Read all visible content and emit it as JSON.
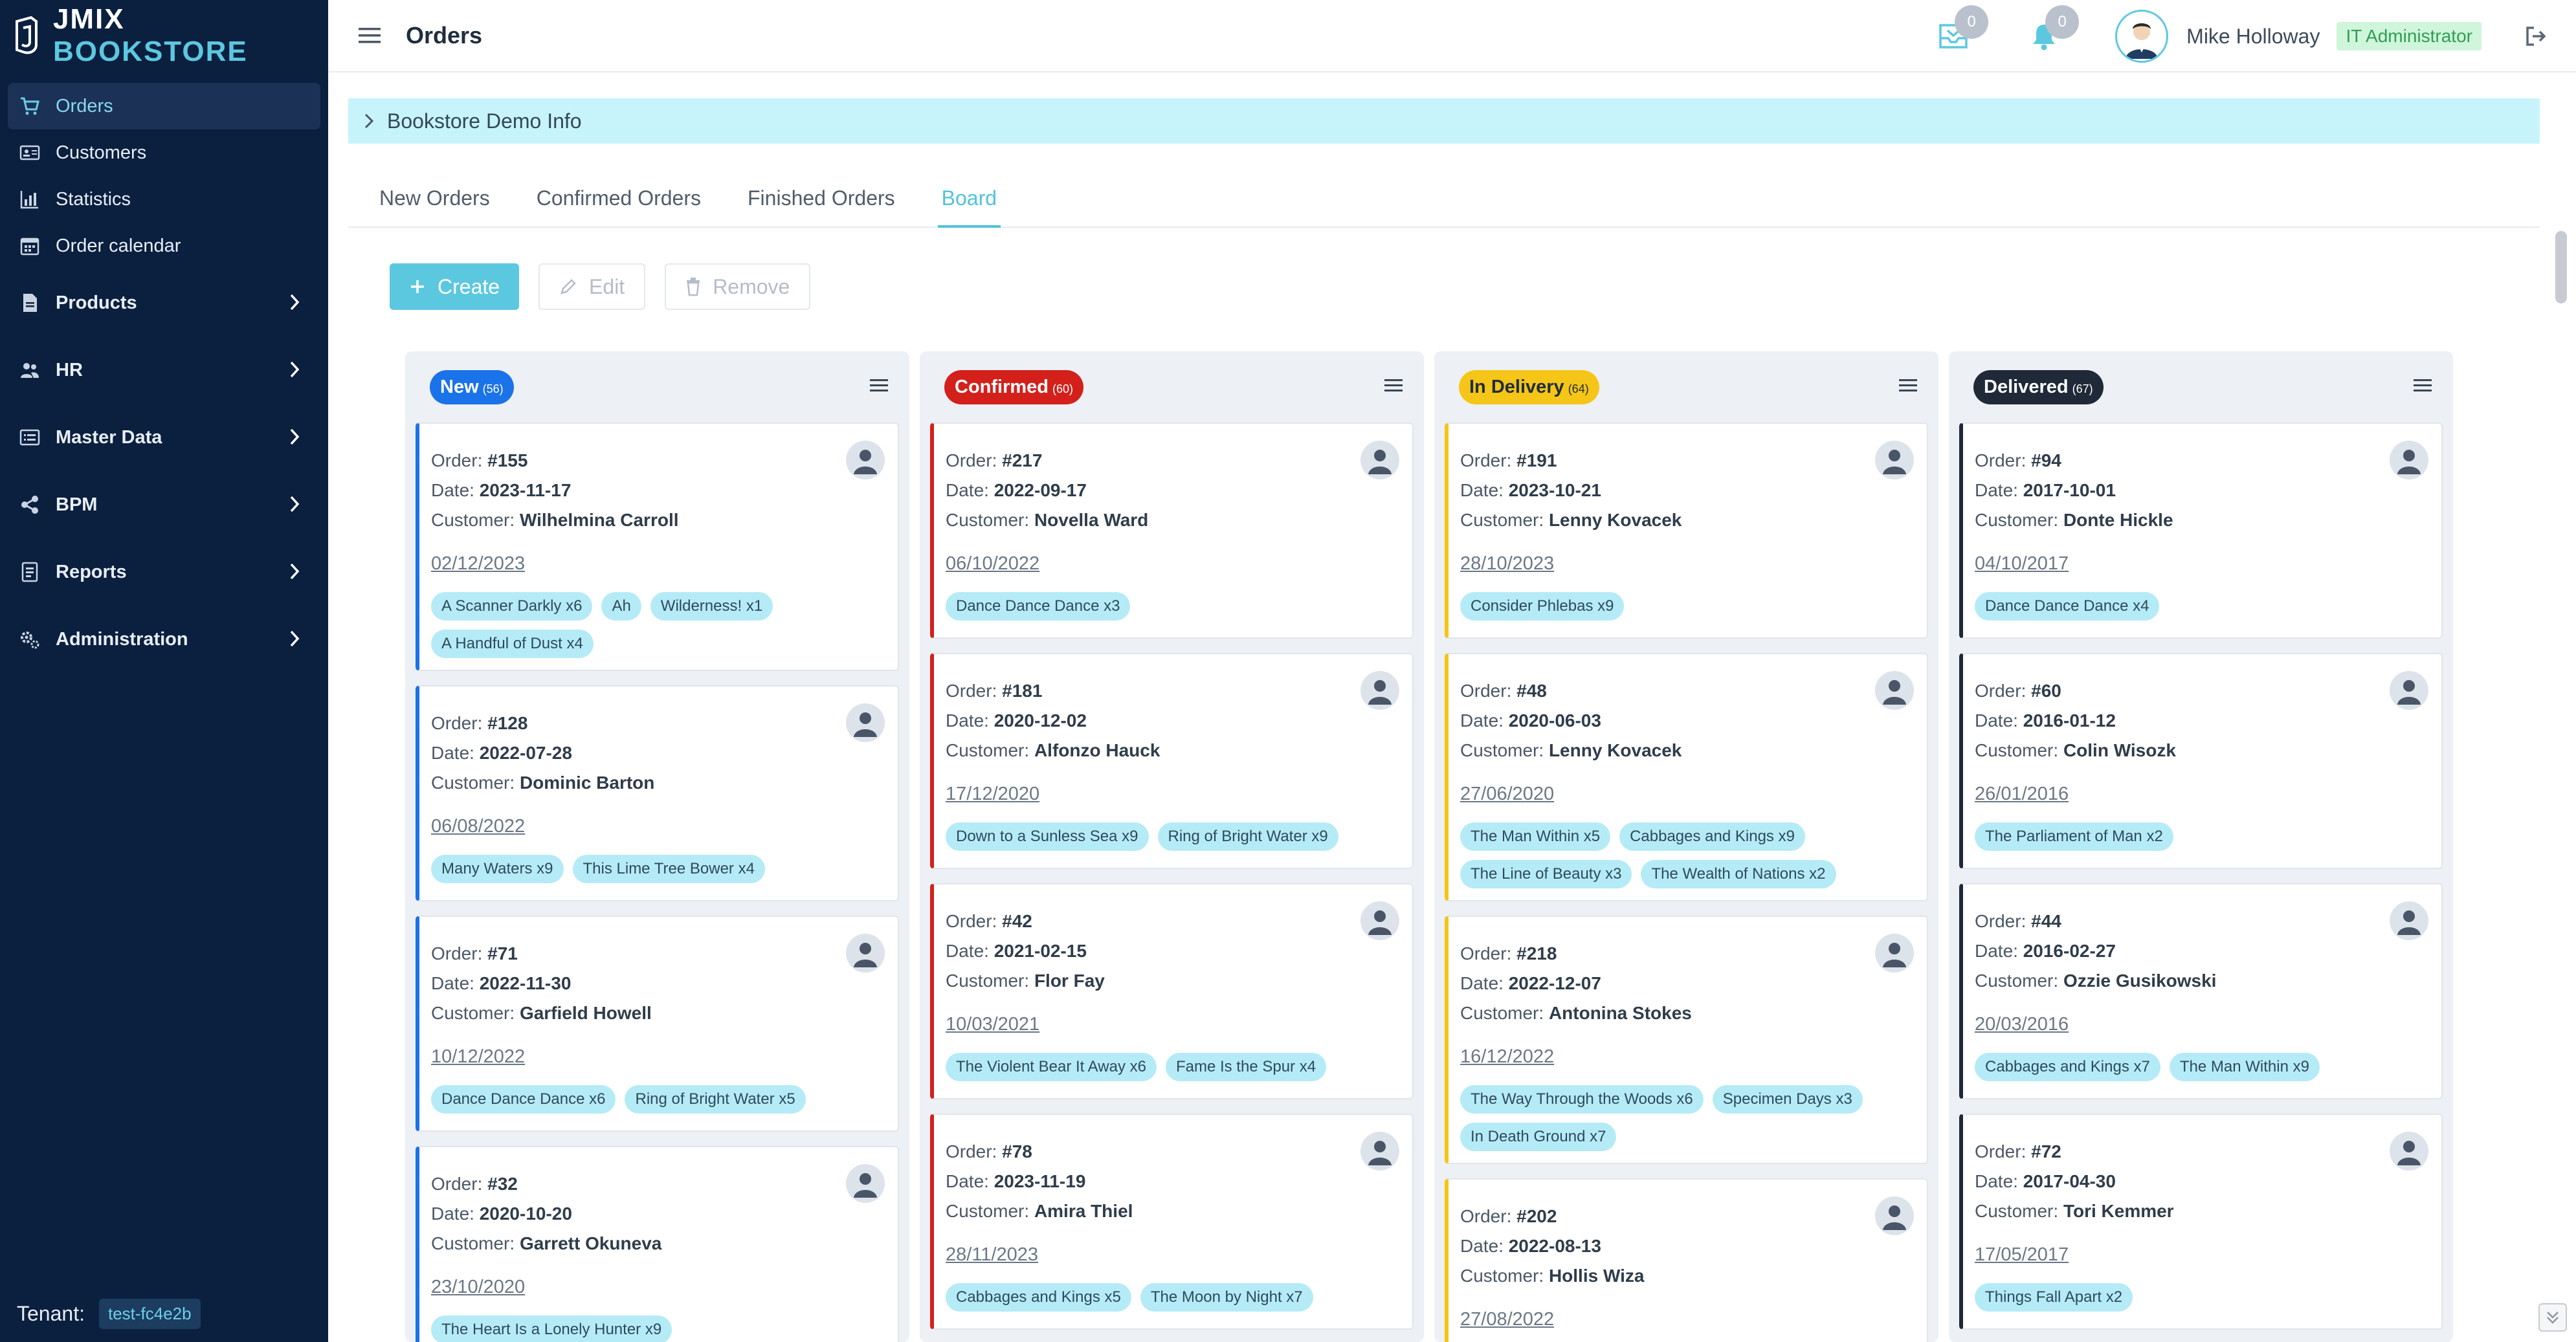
{
  "brand": {
    "prefix": "JMIX",
    "suffix": "BOOKSTORE"
  },
  "sidebar": {
    "items": [
      {
        "label": "Orders",
        "icon": "cart-icon",
        "active": true
      },
      {
        "label": "Customers",
        "icon": "address-card-icon"
      },
      {
        "label": "Statistics",
        "icon": "chart-icon"
      },
      {
        "label": "Order calendar",
        "icon": "calendar-icon"
      }
    ],
    "groups": [
      {
        "label": "Products",
        "icon": "file-icon"
      },
      {
        "label": "HR",
        "icon": "users-icon"
      },
      {
        "label": "Master Data",
        "icon": "list-icon"
      },
      {
        "label": "BPM",
        "icon": "share-icon"
      },
      {
        "label": "Reports",
        "icon": "report-icon"
      },
      {
        "label": "Administration",
        "icon": "cogs-icon"
      }
    ],
    "tenant_label": "Tenant:",
    "tenant_value": "test-fc4e2b"
  },
  "header": {
    "title": "Orders",
    "inbox_count": "0",
    "notifications_count": "0",
    "user_name": "Mike Holloway",
    "role": "IT Administrator"
  },
  "infobar": {
    "label": "Bookstore Demo Info"
  },
  "tabs": [
    "New Orders",
    "Confirmed Orders",
    "Finished Orders",
    "Board"
  ],
  "active_tab": "Board",
  "toolbar": {
    "create": "Create",
    "edit": "Edit",
    "remove": "Remove"
  },
  "card_labels": {
    "order": "Order:",
    "date": "Date:",
    "customer": "Customer:"
  },
  "colors": {
    "new": "#1a73e8",
    "confirmed": "#d3201b",
    "in_delivery": "#f5c518",
    "delivered": "#1f2937",
    "accent": "#5cc8e0",
    "sidebar": "#0b1f3f"
  },
  "columns": [
    {
      "title": "New",
      "count": "(56)",
      "cards": [
        {
          "order": "#155",
          "date": "2023-11-17",
          "customer": "Wilhelmina Carroll",
          "delivery": "02/12/2023",
          "items": [
            "A Scanner Darkly x6",
            "Ah",
            "Wilderness! x1",
            "A Handful of Dust x4"
          ]
        },
        {
          "order": "#128",
          "date": "2022-07-28",
          "customer": "Dominic Barton",
          "delivery": "06/08/2022",
          "items": [
            "Many Waters x9",
            "This Lime Tree Bower x4"
          ]
        },
        {
          "order": "#71",
          "date": "2022-11-30",
          "customer": "Garfield Howell",
          "delivery": "10/12/2022",
          "items": [
            "Dance Dance Dance x6",
            "Ring of Bright Water x5"
          ]
        },
        {
          "order": "#32",
          "date": "2020-10-20",
          "customer": "Garrett Okuneva",
          "delivery": "23/10/2020",
          "items": [
            "The Heart Is a Lonely Hunter x9"
          ]
        }
      ]
    },
    {
      "title": "Confirmed",
      "count": "(60)",
      "cards": [
        {
          "order": "#217",
          "date": "2022-09-17",
          "customer": "Novella Ward",
          "delivery": "06/10/2022",
          "items": [
            "Dance Dance Dance x3"
          ]
        },
        {
          "order": "#181",
          "date": "2020-12-02",
          "customer": "Alfonzo Hauck",
          "delivery": "17/12/2020",
          "items": [
            "Down to a Sunless Sea x9",
            "Ring of Bright Water x9"
          ]
        },
        {
          "order": "#42",
          "date": "2021-02-15",
          "customer": "Flor Fay",
          "delivery": "10/03/2021",
          "items": [
            "The Violent Bear It Away x6",
            "Fame Is the Spur x4"
          ]
        },
        {
          "order": "#78",
          "date": "2023-11-19",
          "customer": "Amira Thiel",
          "delivery": "28/11/2023",
          "items": [
            "Cabbages and Kings x5",
            "The Moon by Night x7"
          ]
        }
      ]
    },
    {
      "title": "In Delivery",
      "count": "(64)",
      "cards": [
        {
          "order": "#191",
          "date": "2023-10-21",
          "customer": "Lenny Kovacek",
          "delivery": "28/10/2023",
          "items": [
            "Consider Phlebas x9"
          ]
        },
        {
          "order": "#48",
          "date": "2020-06-03",
          "customer": "Lenny Kovacek",
          "delivery": "27/06/2020",
          "items": [
            "The Man Within x5",
            "Cabbages and Kings x9",
            "The Line of Beauty x3",
            "The Wealth of Nations x2"
          ]
        },
        {
          "order": "#218",
          "date": "2022-12-07",
          "customer": "Antonina Stokes",
          "delivery": "16/12/2022",
          "items": [
            "The Way Through the Woods x6",
            "Specimen Days x3",
            "In Death Ground x7"
          ]
        },
        {
          "order": "#202",
          "date": "2022-08-13",
          "customer": "Hollis Wiza",
          "delivery": "27/08/2022",
          "items": []
        }
      ]
    },
    {
      "title": "Delivered",
      "count": "(67)",
      "cards": [
        {
          "order": "#94",
          "date": "2017-10-01",
          "customer": "Donte Hickle",
          "delivery": "04/10/2017",
          "items": [
            "Dance Dance Dance x4"
          ]
        },
        {
          "order": "#60",
          "date": "2016-01-12",
          "customer": "Colin Wisozk",
          "delivery": "26/01/2016",
          "items": [
            "The Parliament of Man x2"
          ]
        },
        {
          "order": "#44",
          "date": "2016-02-27",
          "customer": "Ozzie Gusikowski",
          "delivery": "20/03/2016",
          "items": [
            "Cabbages and Kings x7",
            "The Man Within x9"
          ]
        },
        {
          "order": "#72",
          "date": "2017-04-30",
          "customer": "Tori Kemmer",
          "delivery": "17/05/2017",
          "items": [
            "Things Fall Apart x2"
          ]
        }
      ]
    }
  ]
}
